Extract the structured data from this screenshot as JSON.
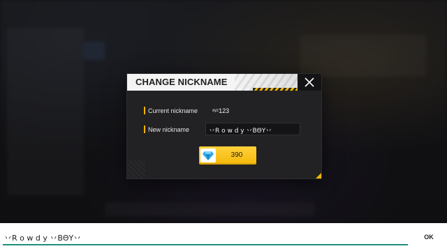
{
  "dialog": {
    "title": "CHANGE NICKNAME",
    "current_label": "Current nickname",
    "current_value": "ˣʸᶻ123",
    "new_label": "New nickname",
    "new_value": "丷R o w d y 丷BΘY丷",
    "price": "390",
    "close_icon": "close-icon",
    "currency_icon": "diamond-icon",
    "accent_color": "#f2b705"
  },
  "keyboard_bar": {
    "text": "丷R o w d y 丷BΘY丷",
    "ok_label": "OK",
    "underline_color": "#1f8f7a"
  }
}
